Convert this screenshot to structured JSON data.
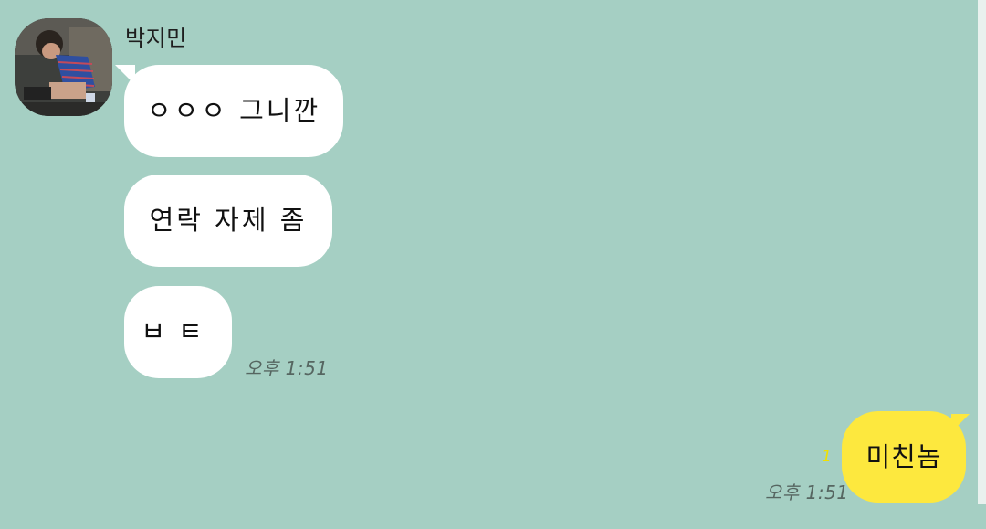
{
  "chat": {
    "sender_name": "박지민",
    "received": [
      {
        "text": "ㅇㅇㅇ 그니깐"
      },
      {
        "text": "연락 자제 좀"
      },
      {
        "text": "ㅂㅌ"
      }
    ],
    "received_time": "오후 1:51",
    "sent": [
      {
        "text": "미친놈"
      }
    ],
    "sent_unread": "1",
    "sent_time": "오후 1:51"
  },
  "colors": {
    "background": "#a5cfc3",
    "received_bubble": "#ffffff",
    "sent_bubble": "#fde83e",
    "unread_indicator": "#f0e000"
  },
  "icons": {
    "avatar": "profile-photo"
  }
}
